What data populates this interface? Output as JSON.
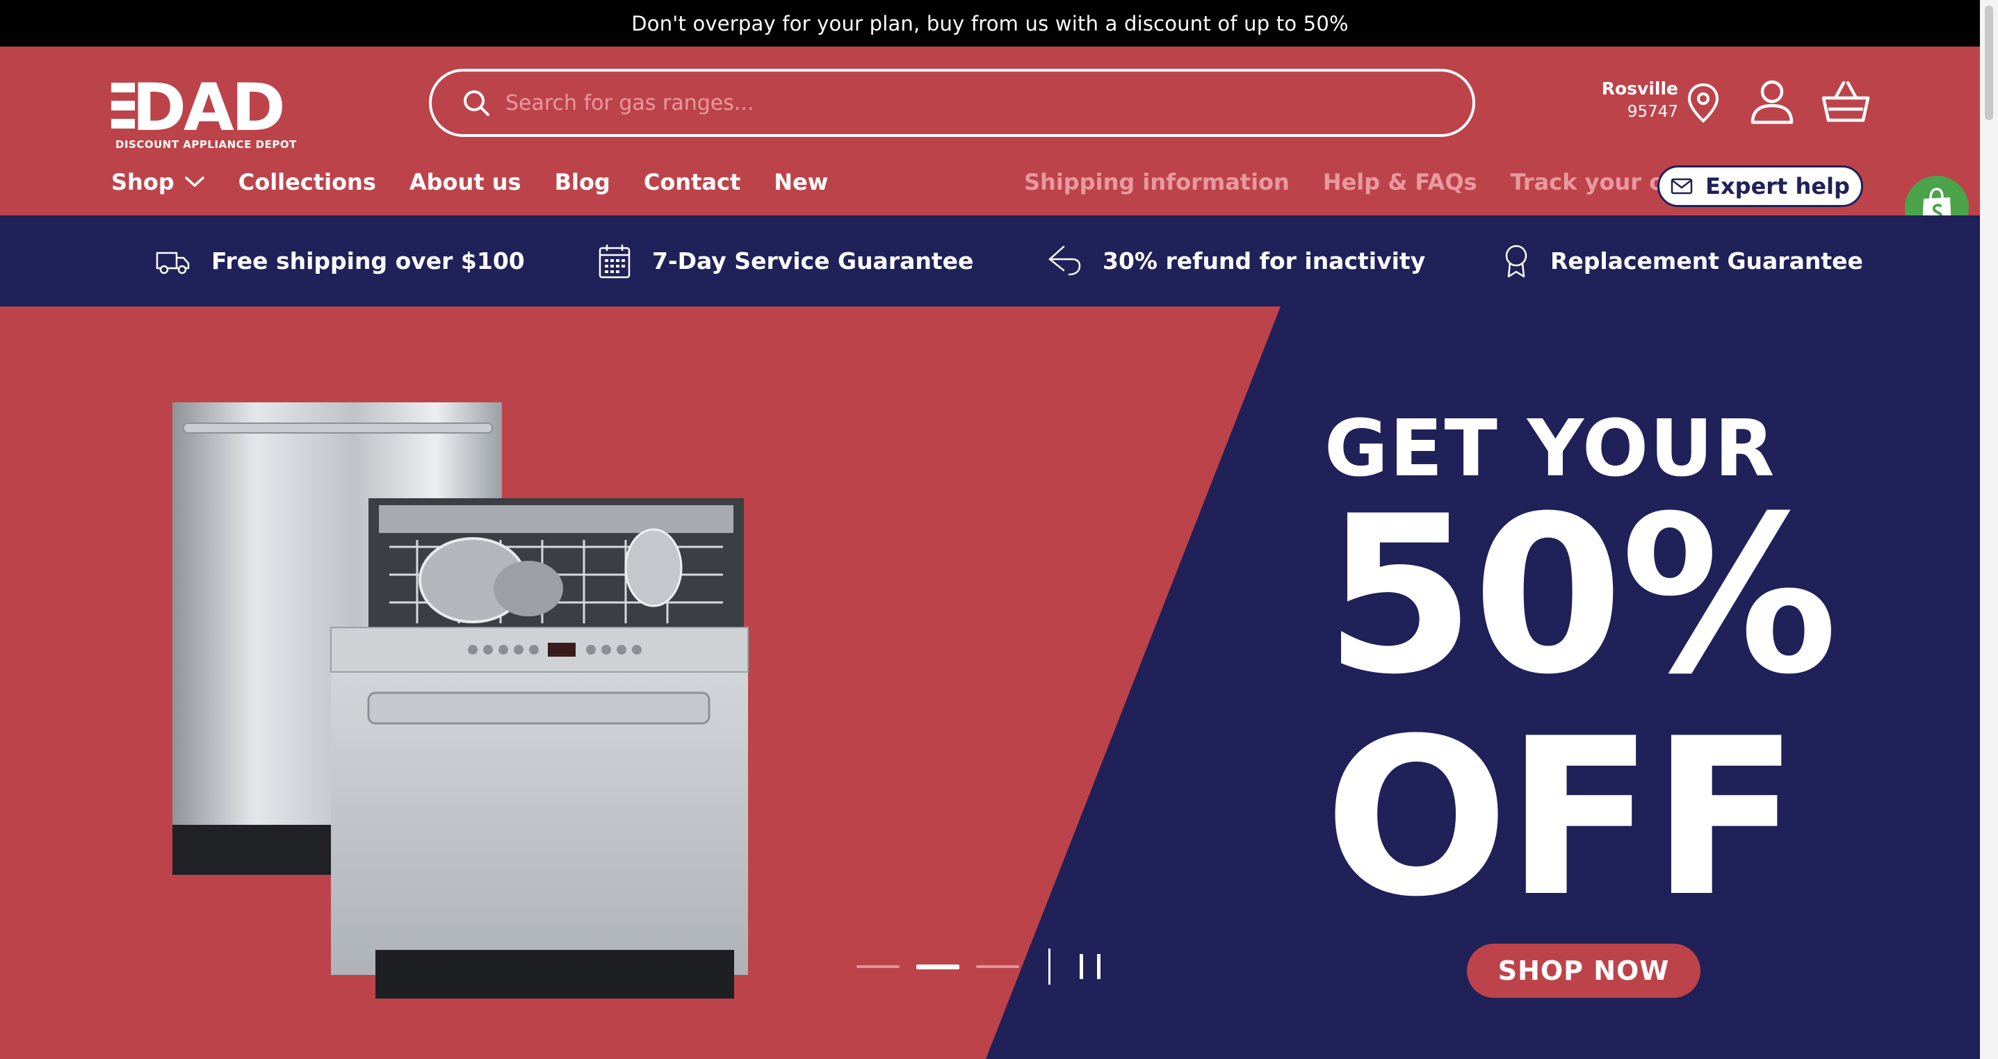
{
  "announcement": "Don't overpay for your plan, buy from us with a discount of up to 50%",
  "logo": {
    "wordmark": "DAD",
    "subtitle": "DISCOUNT APPLIANCE DEPOT"
  },
  "search": {
    "placeholder": "Search for gas ranges..."
  },
  "location": {
    "city": "Rosville",
    "zip": "95747"
  },
  "nav": [
    {
      "label": "Shop",
      "has_dropdown": true
    },
    {
      "label": "Collections"
    },
    {
      "label": "About us"
    },
    {
      "label": "Blog"
    },
    {
      "label": "Contact"
    },
    {
      "label": "New"
    }
  ],
  "utility_links": [
    "Shipping information",
    "Help & FAQs",
    "Track your order"
  ],
  "expert_help": {
    "label": "Expert help",
    "icon": "mail-icon"
  },
  "usp": [
    {
      "label": "Free shipping over $100",
      "icon": "truck-icon"
    },
    {
      "label": "7-Day Service Guarantee",
      "icon": "calendar-icon"
    },
    {
      "label": "30% refund for inactivity",
      "icon": "return-arrow-icon"
    },
    {
      "label": "Replacement Guarantee",
      "icon": "award-icon"
    }
  ],
  "hero": {
    "line1": "GET YOUR",
    "line2": "50%",
    "line3": "OFF",
    "cta": "SHOP NOW",
    "slides_total": 3,
    "active_slide": 2
  },
  "colors": {
    "brand_red": "#bd434a",
    "navy": "#1f2158",
    "shopify_green": "#4ba34a",
    "muted_link": "#e89a9e"
  }
}
